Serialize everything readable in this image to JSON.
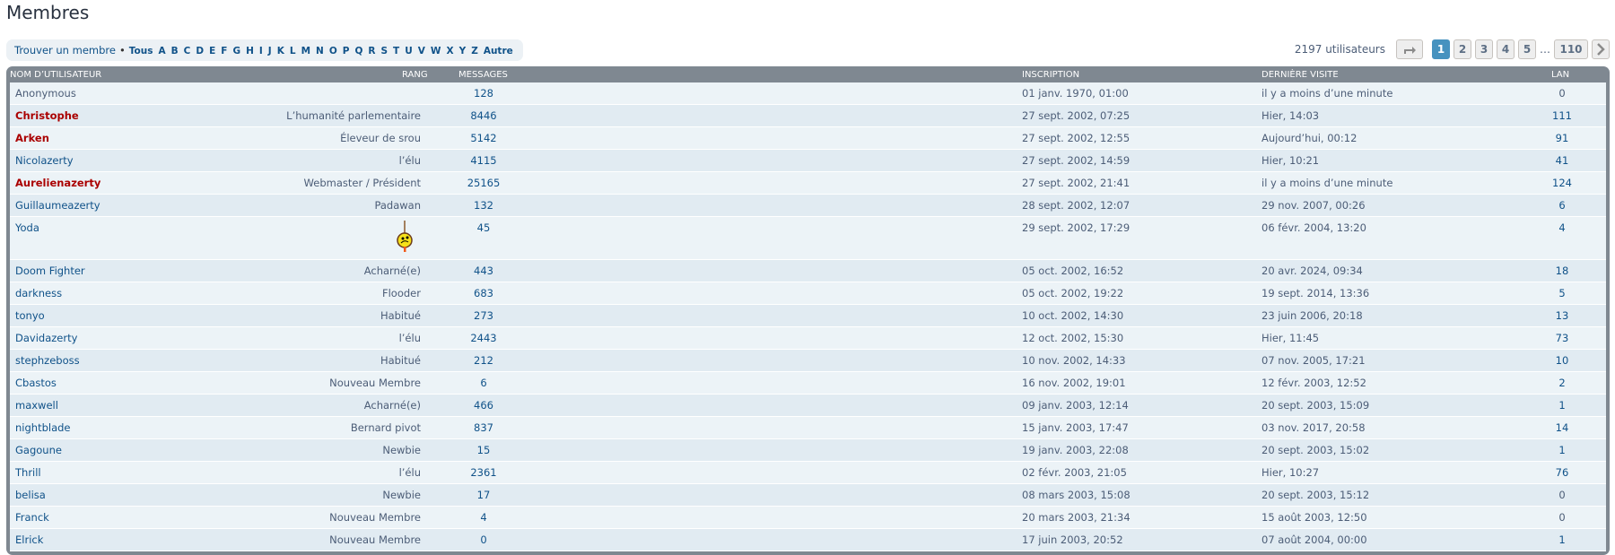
{
  "title": "Membres",
  "find": {
    "label": "Trouver un membre",
    "sep": "•",
    "letters": [
      "Tous",
      "A",
      "B",
      "C",
      "D",
      "E",
      "F",
      "G",
      "H",
      "I",
      "J",
      "K",
      "L",
      "M",
      "N",
      "O",
      "P",
      "Q",
      "R",
      "S",
      "T",
      "U",
      "V",
      "W",
      "X",
      "Y",
      "Z",
      "Autre"
    ]
  },
  "pagination": {
    "count": "2197 utilisateurs",
    "jump_icon": "share-arrow-icon",
    "pages": [
      "1",
      "2",
      "3",
      "4",
      "5"
    ],
    "ellipsis": "…",
    "last": "110",
    "next_icon": "chevron-right-icon",
    "active": "1"
  },
  "columns": {
    "name": "Nom d’utilisateur",
    "rang": "Rang",
    "messages": "Messages",
    "inscription": "Inscription",
    "visit": "Dernière visite",
    "lan": "LAN"
  },
  "colors": {
    "header": "#7f8891",
    "link": "#105289",
    "admin": "#aa0000",
    "active_page": "#4692bf"
  },
  "rows": [
    {
      "name": "Anonymous",
      "rang": "",
      "messages": "128",
      "inscription": "01 janv. 1970, 01:00",
      "visit": "il y a moins d’une minute",
      "lan": "0",
      "type": "plain"
    },
    {
      "name": "Christophe",
      "rang": "L’humanité parlementaire",
      "messages": "8446",
      "inscription": "27 sept. 2002, 07:25",
      "visit": "Hier, 14:03",
      "lan": "111",
      "type": "admin"
    },
    {
      "name": "Arken",
      "rang": "Éleveur de srou",
      "messages": "5142",
      "inscription": "27 sept. 2002, 12:55",
      "visit": "Aujourd’hui, 00:12",
      "lan": "91",
      "type": "admin"
    },
    {
      "name": "Nicolazerty",
      "rang": "l’élu",
      "messages": "4115",
      "inscription": "27 sept. 2002, 14:59",
      "visit": "Hier, 10:21",
      "lan": "41",
      "type": "user"
    },
    {
      "name": "Aurelienazerty",
      "rang": "Webmaster / Président",
      "messages": "25165",
      "inscription": "27 sept. 2002, 21:41",
      "visit": "il y a moins d’une minute",
      "lan": "124",
      "type": "admin"
    },
    {
      "name": "Guillaumeazerty",
      "rang": "Padawan",
      "messages": "132",
      "inscription": "28 sept. 2002, 12:07",
      "visit": "29 nov. 2007, 00:26",
      "lan": "6",
      "type": "user"
    },
    {
      "name": "Yoda",
      "rang": "",
      "rank_icon": "hanged-smiley-icon",
      "messages": "45",
      "inscription": "29 sept. 2002, 17:29",
      "visit": "06 févr. 2004, 13:20",
      "lan": "4",
      "type": "user"
    },
    {
      "name": "Doom Fighter",
      "rang": "Acharné(e)",
      "messages": "443",
      "inscription": "05 oct. 2002, 16:52",
      "visit": "20 avr. 2024, 09:34",
      "lan": "18",
      "type": "user"
    },
    {
      "name": "darkness",
      "rang": "Flooder",
      "messages": "683",
      "inscription": "05 oct. 2002, 19:22",
      "visit": "19 sept. 2014, 13:36",
      "lan": "5",
      "type": "user"
    },
    {
      "name": "tonyo",
      "rang": "Habitué",
      "messages": "273",
      "inscription": "10 oct. 2002, 14:30",
      "visit": "23 juin 2006, 20:18",
      "lan": "13",
      "type": "user"
    },
    {
      "name": "Davidazerty",
      "rang": "l’élu",
      "messages": "2443",
      "inscription": "12 oct. 2002, 15:30",
      "visit": "Hier, 11:45",
      "lan": "73",
      "type": "user"
    },
    {
      "name": "stephzeboss",
      "rang": "Habitué",
      "messages": "212",
      "inscription": "10 nov. 2002, 14:33",
      "visit": "07 nov. 2005, 17:21",
      "lan": "10",
      "type": "user"
    },
    {
      "name": "Cbastos",
      "rang": "Nouveau Membre",
      "messages": "6",
      "inscription": "16 nov. 2002, 19:01",
      "visit": "12 févr. 2003, 12:52",
      "lan": "2",
      "type": "user"
    },
    {
      "name": "maxwell",
      "rang": "Acharné(e)",
      "messages": "466",
      "inscription": "09 janv. 2003, 12:14",
      "visit": "20 sept. 2003, 15:09",
      "lan": "1",
      "type": "user"
    },
    {
      "name": "nightblade",
      "rang": "Bernard pivot",
      "messages": "837",
      "inscription": "15 janv. 2003, 17:47",
      "visit": "03 nov. 2017, 20:58",
      "lan": "14",
      "type": "user"
    },
    {
      "name": "Gagoune",
      "rang": "Newbie",
      "messages": "15",
      "inscription": "19 janv. 2003, 22:08",
      "visit": "20 sept. 2003, 15:02",
      "lan": "1",
      "type": "user"
    },
    {
      "name": "Thrill",
      "rang": "l’élu",
      "messages": "2361",
      "inscription": "02 févr. 2003, 21:05",
      "visit": "Hier, 10:27",
      "lan": "76",
      "type": "user"
    },
    {
      "name": "belisa",
      "rang": "Newbie",
      "messages": "17",
      "inscription": "08 mars 2003, 15:08",
      "visit": "20 sept. 2003, 15:12",
      "lan": "0",
      "type": "user"
    },
    {
      "name": "Franck",
      "rang": "Nouveau Membre",
      "messages": "4",
      "inscription": "20 mars 2003, 21:34",
      "visit": "15 août 2003, 12:50",
      "lan": "0",
      "type": "user"
    },
    {
      "name": "Elrick",
      "rang": "Nouveau Membre",
      "messages": "0",
      "inscription": "17 juin 2003, 20:52",
      "visit": "07 août 2004, 00:00",
      "lan": "1",
      "type": "user"
    }
  ]
}
